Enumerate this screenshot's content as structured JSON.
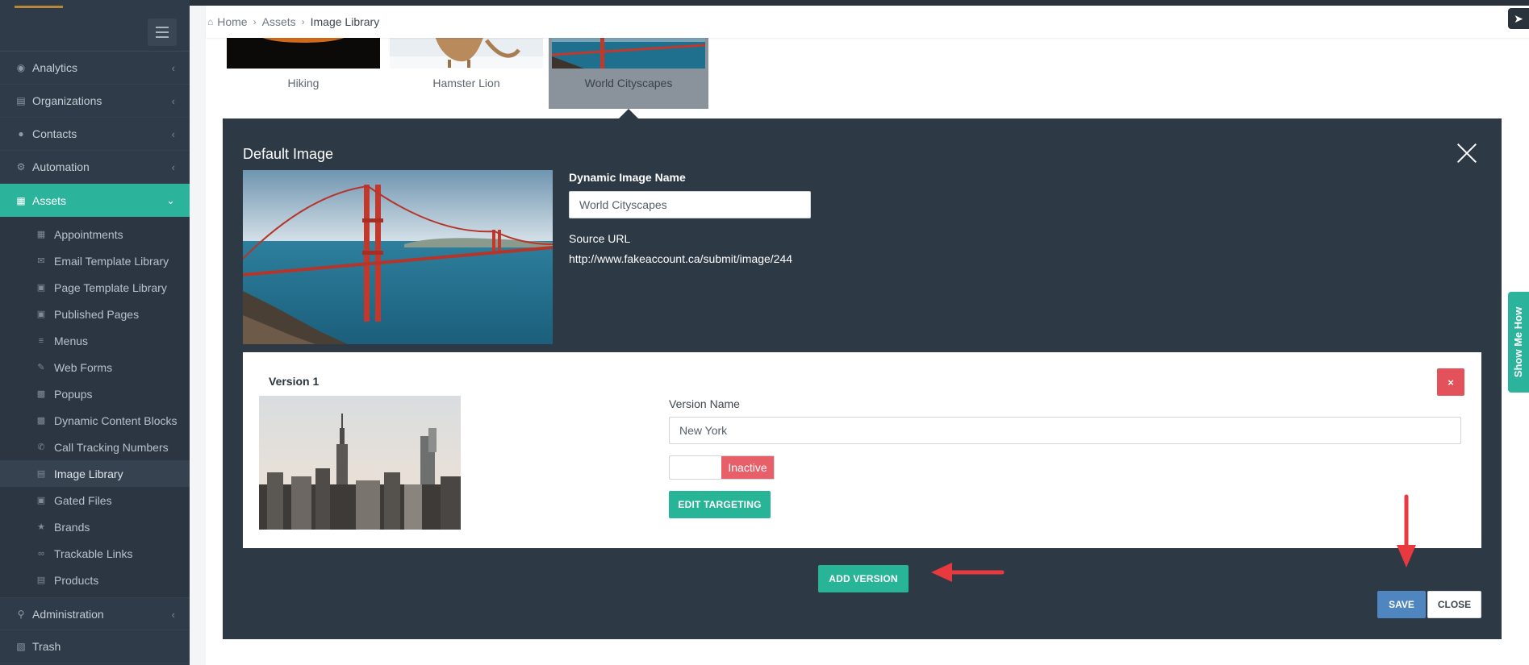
{
  "sidebar": {
    "items": [
      {
        "label": "Analytics",
        "icon": "analytics-icon"
      },
      {
        "label": "Organizations",
        "icon": "organizations-icon"
      },
      {
        "label": "Contacts",
        "icon": "contacts-icon"
      },
      {
        "label": "Automation",
        "icon": "automation-icon"
      },
      {
        "label": "Assets",
        "icon": "assets-icon"
      }
    ],
    "assets_sub": [
      {
        "label": "Appointments"
      },
      {
        "label": "Email Template Library"
      },
      {
        "label": "Page Template Library"
      },
      {
        "label": "Published Pages"
      },
      {
        "label": "Menus"
      },
      {
        "label": "Web Forms"
      },
      {
        "label": "Popups"
      },
      {
        "label": "Dynamic Content Blocks"
      },
      {
        "label": "Call Tracking Numbers"
      },
      {
        "label": "Image Library"
      },
      {
        "label": "Gated Files"
      },
      {
        "label": "Brands"
      },
      {
        "label": "Trackable Links"
      },
      {
        "label": "Products"
      }
    ],
    "bottom": [
      {
        "label": "Administration"
      },
      {
        "label": "Trash"
      }
    ]
  },
  "breadcrumb": {
    "home": "Home",
    "assets": "Assets",
    "current": "Image Library"
  },
  "thumbnails": [
    {
      "caption": "Hiking"
    },
    {
      "caption": "Hamster Lion"
    },
    {
      "caption": "World Cityscapes"
    }
  ],
  "panel": {
    "title": "Default Image",
    "name_label": "Dynamic Image Name",
    "name_value": "World Cityscapes",
    "url_label": "Source URL",
    "url_value": "http://www.fakeaccount.ca/submit/image/244"
  },
  "version": {
    "title": "Version 1",
    "name_label": "Version Name",
    "name_value": "New York",
    "status": "Inactive",
    "edit_targeting": "EDIT TARGETING",
    "delete_symbol": "×"
  },
  "actions": {
    "add_version": "ADD VERSION",
    "save": "SAVE",
    "close": "CLOSE"
  },
  "show_me_how": "Show Me How",
  "colors": {
    "sidebar": "#2f3b48",
    "accent": "#2bb39b",
    "panel": "#2e3946",
    "save": "#4f86c0",
    "danger": "#e3525a",
    "arrow": "#e8393f"
  }
}
